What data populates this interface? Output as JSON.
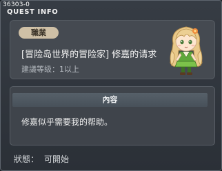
{
  "window": {
    "quest_id": "36303-0",
    "title": "QUEST INFO"
  },
  "quest": {
    "category_badge": "職業",
    "name": "[冒险岛世界的冒险家] 修嘉的请求",
    "level_label": "建議等级：1以上"
  },
  "content": {
    "tab_label": "內容",
    "description": "修嘉似乎需要我的帮助。"
  },
  "status": {
    "label": "狀態：",
    "value": "可開始"
  },
  "npc": {
    "icon": "npc-girl-portrait"
  }
}
